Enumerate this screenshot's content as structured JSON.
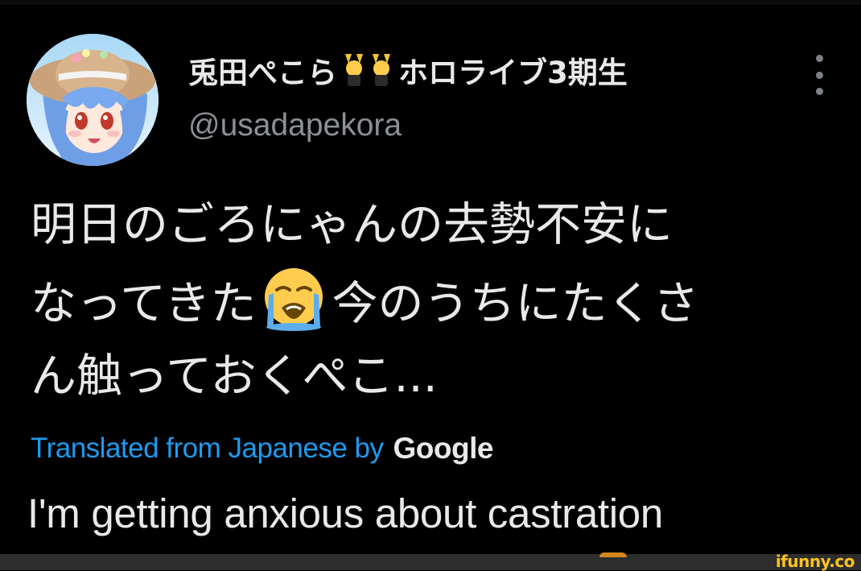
{
  "tweet": {
    "display_name_part1": "兎田ぺこら",
    "display_name_part2": "ホロライブ3期生",
    "name_emoji": "people-with-bunny-ears-emoji",
    "handle": "@usadapekora",
    "more_icon": "more-vertical-icon",
    "text_lines": [
      "明日のごろにゃんの去勢不安に",
      "なってきた",
      "今のうちにたくさ",
      "ん触っておくぺこ..."
    ],
    "text_emoji": "loudly-crying-face-emoji",
    "translated_label": "Translated from Japanese by",
    "translator": "Google",
    "translation": "I'm getting anxious about castration"
  },
  "watermark": "ifunny.co",
  "colors": {
    "background": "#000000",
    "text": "#e7e9ea",
    "secondary_text": "#8b9096",
    "link": "#1d9bf0",
    "watermark": "#ffc31f"
  }
}
